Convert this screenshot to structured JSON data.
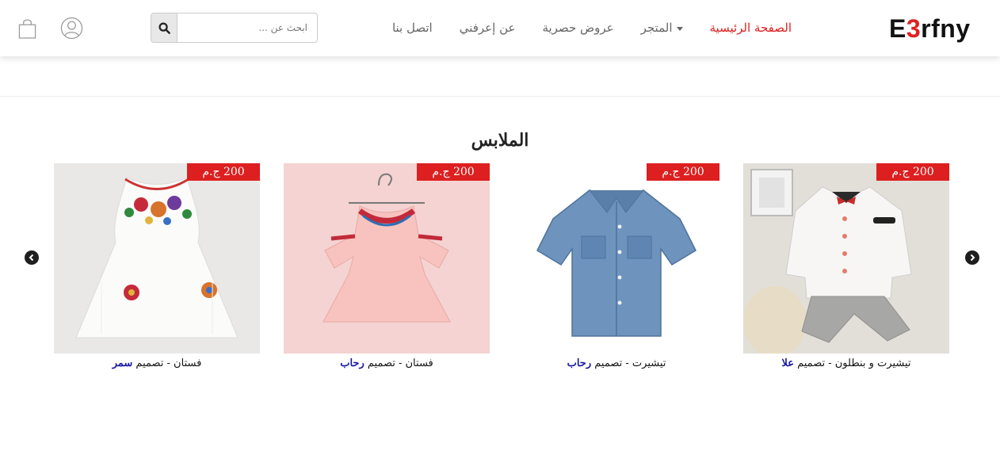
{
  "header": {
    "logo_prefix": "E",
    "logo_accent": "3",
    "logo_suffix": "rfny",
    "nav": [
      {
        "label": "الصفحة الرئيسية",
        "active": true
      },
      {
        "label": "المتجر",
        "active": false,
        "dropdown": true
      },
      {
        "label": "عروض حصرية",
        "active": false
      },
      {
        "label": "عن إعرفني",
        "active": false
      },
      {
        "label": "اتصل بنا",
        "active": false
      }
    ],
    "search": {
      "placeholder": "ابحث عن ..."
    }
  },
  "section": {
    "title": "الملابس"
  },
  "products": [
    {
      "price": "200 ج.م",
      "title": "تيشيرت و بنطلون - تصميم",
      "designer": "علا"
    },
    {
      "price": "200 ج.م",
      "title": "تيشيرت - تصميم",
      "designer": "رحاب"
    },
    {
      "price": "200 ج.م",
      "title": "فستان - تصميم",
      "designer": "رحاب"
    },
    {
      "price": "200 ج.م",
      "title": "فستان - تصميم",
      "designer": "سمر"
    }
  ],
  "colors": {
    "accent": "#e02020",
    "price_badge": "#dd1f1f",
    "designer_link": "#1a1aa6"
  },
  "icons": [
    "search-icon",
    "user-icon",
    "cart-icon",
    "chevron-left-icon",
    "chevron-right-icon"
  ]
}
